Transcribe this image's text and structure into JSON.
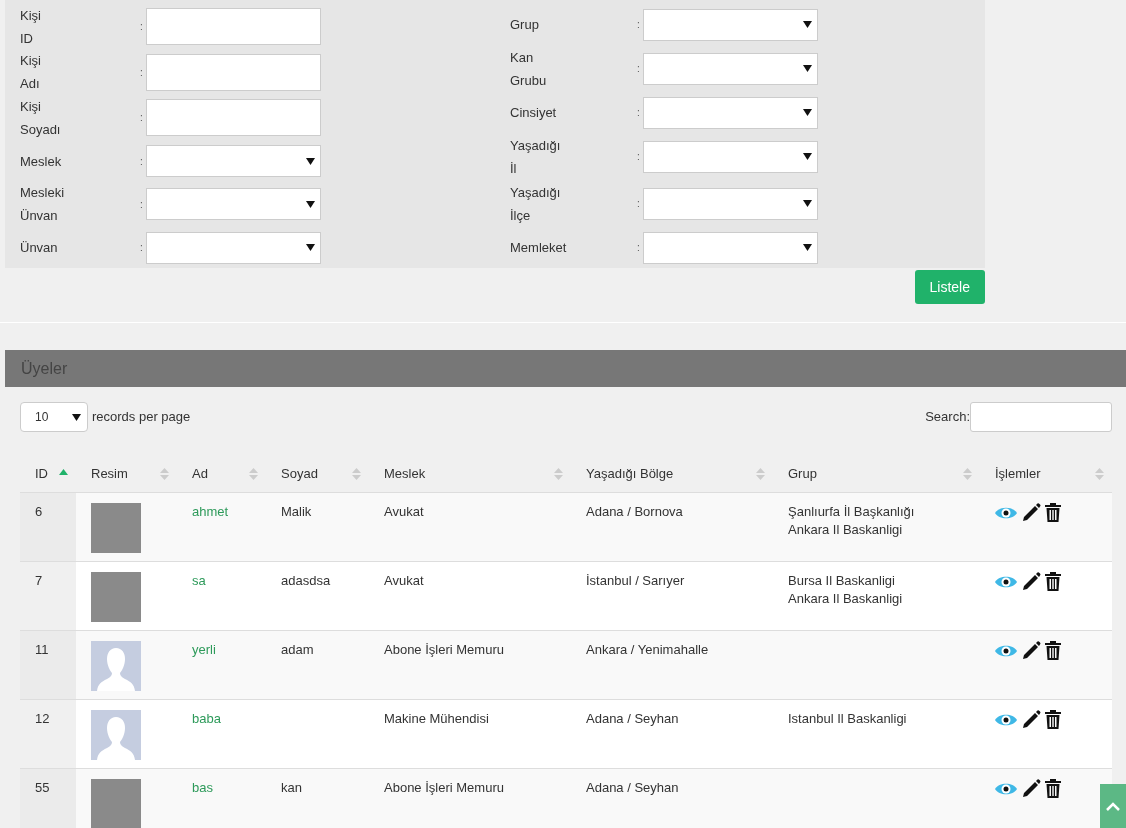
{
  "filters": {
    "left": [
      {
        "label": "Kişi ID",
        "kind": "text"
      },
      {
        "label": "Kişi Adı",
        "kind": "text"
      },
      {
        "label": "Kişi Soyadı",
        "kind": "text"
      },
      {
        "label": "Meslek",
        "kind": "select"
      },
      {
        "label": "Mesleki Ünvan",
        "kind": "select"
      },
      {
        "label": "Ünvan",
        "kind": "select"
      }
    ],
    "right": [
      {
        "label": "Grup",
        "kind": "select"
      },
      {
        "label": "Kan Grubu",
        "kind": "select"
      },
      {
        "label": "Cinsiyet",
        "kind": "select"
      },
      {
        "label": "Yaşadığı İl",
        "kind": "select"
      },
      {
        "label": "Yaşadığı İlçe",
        "kind": "select"
      },
      {
        "label": "Memleket",
        "kind": "select"
      }
    ],
    "separator": ":",
    "button": "Listele"
  },
  "panel": {
    "title": "Üyeler",
    "page_length": "10",
    "page_length_label": "records per page",
    "search_label": "Search:"
  },
  "table": {
    "columns": [
      {
        "label": "ID",
        "sorted": true
      },
      {
        "label": "Resim",
        "sorted": false
      },
      {
        "label": "Ad",
        "sorted": false
      },
      {
        "label": "Soyad",
        "sorted": false
      },
      {
        "label": "Meslek",
        "sorted": false
      },
      {
        "label": "Yaşadığı Bölge",
        "sorted": false
      },
      {
        "label": "Grup",
        "sorted": false
      },
      {
        "label": "İşlemler",
        "sorted": false
      }
    ],
    "rows": [
      {
        "id": "6",
        "kind": "photo",
        "ad": "ahmet",
        "soyad": "Malik",
        "meslek": "Avukat",
        "bolge": "Adana / Bornova",
        "grup": [
          "Şanlıurfa İl Başkanlığı",
          "Ankara Il Baskanligi"
        ]
      },
      {
        "id": "7",
        "kind": "photo",
        "ad": "sa",
        "soyad": "adasdsa",
        "meslek": "Avukat",
        "bolge": "İstanbul / Sarıyer",
        "grup": [
          "Bursa Il Baskanligi",
          "Ankara Il Baskanligi"
        ]
      },
      {
        "id": "11",
        "kind": "silhouette",
        "ad": "yerli",
        "soyad": "adam",
        "meslek": "Abone İşleri Memuru",
        "bolge": "Ankara / Yenimahalle"
      },
      {
        "id": "12",
        "kind": "silhouette",
        "ad": "baba",
        "meslek": "Makine Mühendisi",
        "bolge": "Adana / Seyhan",
        "grup": [
          "Istanbul Il Baskanligi"
        ]
      },
      {
        "id": "55",
        "kind": "photo",
        "ad": "bas",
        "soyad": "kan",
        "meslek": "Abone İşleri Memuru",
        "bolge": "Adana / Seyhan"
      }
    ]
  }
}
